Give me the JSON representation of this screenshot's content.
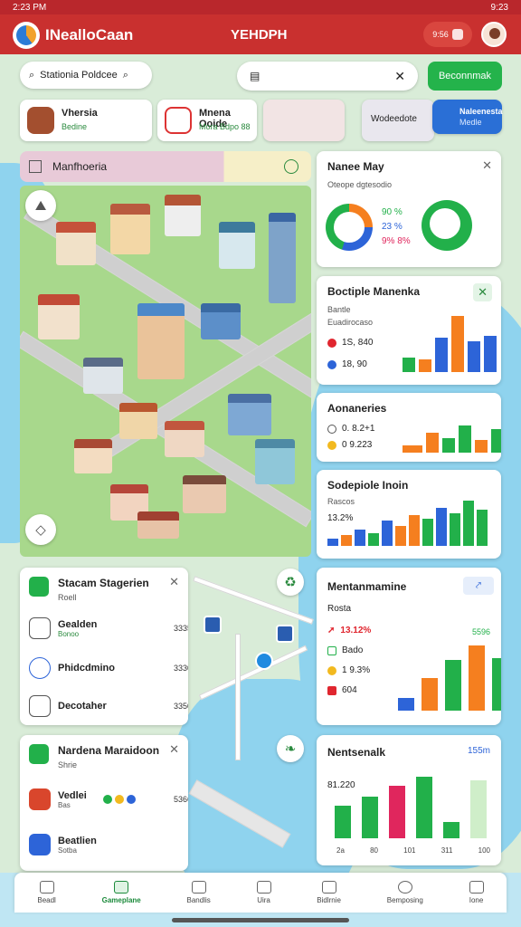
{
  "status_bar": {
    "time": "2:23 PM",
    "right": "9:23"
  },
  "app_bar": {
    "title": "INealloCaan",
    "center": "YEHDPH",
    "notif": "9:56"
  },
  "search": {
    "left_placeholder": "Stationia Poldcee",
    "right_placeholder": ""
  },
  "search_button": "Beconnmak",
  "chips": [
    {
      "title": "Vhersia",
      "sub": "Bedine"
    },
    {
      "title": "Mnena Ooide",
      "sub": "Mora Bdpo 88"
    },
    {
      "title": "",
      "sub": ""
    },
    {
      "title": "Wodeedote",
      "sub": ""
    },
    {
      "title": "Naleenesta",
      "sub": "Medle"
    }
  ],
  "layer_bar": {
    "label": "Manfhoeria"
  },
  "cards": {
    "mana_may": {
      "title": "Nanee May",
      "sub": "Oteope dgtesodio",
      "v1": "90 %",
      "v2": "23 %",
      "v3": "9% 8%"
    },
    "bootiple": {
      "title": "Boctiple Manenka",
      "sub": "Bantle",
      "sub2": "Euadirocaso",
      "r1": "1S, 840",
      "r2": "18, 90"
    },
    "aonaries": {
      "title": "Aonaneries",
      "r1": "0. 8.2+1",
      "r2": "0 9.223"
    },
    "sodepiole": {
      "title": "Sodepiole Inoin",
      "sub": "Rascos",
      "sub2": "13.2%"
    },
    "stacam": {
      "title": "Stacam Stagerien",
      "sub": "Roell",
      "items": [
        {
          "name": "Gealden",
          "meta": "Bonoo",
          "value": "3335"
        },
        {
          "name": "Phidcdmino",
          "meta": "",
          "value": "3330"
        },
        {
          "name": "Decotaher",
          "meta": "",
          "value": "3350"
        }
      ]
    },
    "mentanmine": {
      "title": "Mentanmamine",
      "sub": "Rosta",
      "r1": "13.12%",
      "r2": "Bado",
      "r3": "1 9.3%",
      "r4": "604",
      "tag": "5596"
    },
    "nardena": {
      "title": "Nardena Maraidoon",
      "sub": "Shrie",
      "items": [
        {
          "name": "Vedlei",
          "meta": "Bas",
          "value": "5366"
        },
        {
          "name": "Beatlien",
          "meta": "Sotba",
          "value": ""
        }
      ]
    },
    "nentsenalk": {
      "title": "Nentsenalk",
      "tag": "155m",
      "r1": "81.220",
      "ticks": [
        "2a",
        "80",
        "101",
        "311",
        "100"
      ]
    }
  },
  "chart_colors": {
    "green": "#22b04a",
    "orange": "#f57f1f",
    "blue": "#2d64d8",
    "red": "#e0265d"
  },
  "bottom_nav": [
    {
      "label": "Beadl",
      "icon": "home-icon"
    },
    {
      "label": "Gameplane",
      "icon": "map-icon",
      "active": true
    },
    {
      "label": "Bandlis",
      "icon": "layers-icon"
    },
    {
      "label": "Uira",
      "icon": "list-icon"
    },
    {
      "label": "Bidlrnie",
      "icon": "edit-icon"
    },
    {
      "label": "Bemposing",
      "icon": "user-icon"
    },
    {
      "label": "Ione",
      "icon": "menu-icon"
    }
  ]
}
